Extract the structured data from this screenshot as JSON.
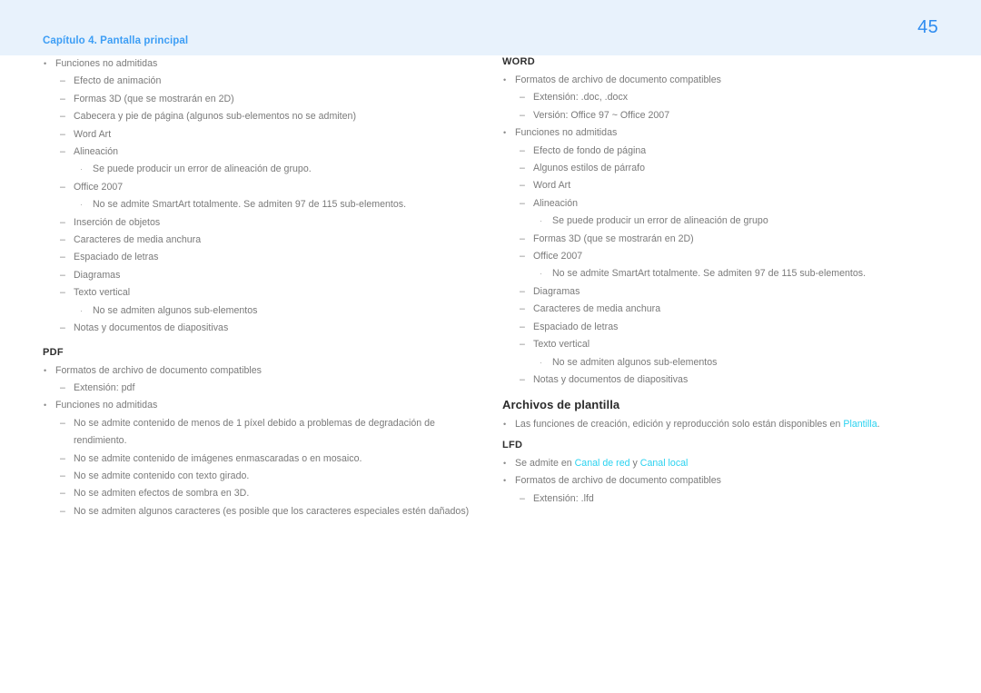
{
  "header": {
    "chapter_title": "Capítulo 4. Pantalla principal",
    "page_number": "45",
    "band_color": "#e8f2fc",
    "title_color": "#3d9ef5",
    "page_number_color": "#2e8cf0"
  },
  "colors": {
    "body_text": "#7a7a7a",
    "heading": "#2e2e2e",
    "link": "#2ad2f0"
  },
  "markers": {
    "bullet": "•",
    "dash": "–",
    "dot": "·"
  },
  "left_column": {
    "blocks": [
      {
        "type": "list",
        "items": [
          {
            "level": 1,
            "text": "Funciones no admitidas"
          },
          {
            "level": 2,
            "text": "Efecto de animación"
          },
          {
            "level": 2,
            "text": "Formas 3D (que se mostrarán en  2D)"
          },
          {
            "level": 2,
            "text": "Cabecera y pie de página (algunos sub-elementos no se admiten)"
          },
          {
            "level": 2,
            "text": "Word Art"
          },
          {
            "level": 2,
            "text": "Alineación"
          },
          {
            "level": 3,
            "text": "Se puede producir un error de alineación de grupo."
          },
          {
            "level": 2,
            "text": "Office 2007"
          },
          {
            "level": 3,
            "text": "No se admite SmartArt totalmente. Se admiten 97 de 115 sub-elementos."
          },
          {
            "level": 2,
            "text": "Inserción de objetos"
          },
          {
            "level": 2,
            "text": "Caracteres de media anchura"
          },
          {
            "level": 2,
            "text": "Espaciado de letras"
          },
          {
            "level": 2,
            "text": "Diagramas"
          },
          {
            "level": 2,
            "text": "Texto vertical"
          },
          {
            "level": 3,
            "text": "No se admiten algunos sub-elementos"
          },
          {
            "level": 2,
            "text": "Notas y documentos de diapositivas"
          }
        ]
      },
      {
        "type": "heading_caps",
        "text": "PDF"
      },
      {
        "type": "list",
        "items": [
          {
            "level": 1,
            "text": "Formatos de archivo de documento compatibles"
          },
          {
            "level": 2,
            "text": "Extensión: pdf"
          },
          {
            "level": 1,
            "text": "Funciones no admitidas"
          },
          {
            "level": 2,
            "text": "No se admite contenido de menos de 1 píxel debido a problemas de degradación de rendimiento."
          },
          {
            "level": 2,
            "text": "No se admite contenido de imágenes enmascaradas o en mosaico."
          },
          {
            "level": 2,
            "text": "No se admite contenido con texto girado."
          },
          {
            "level": 2,
            "text": "No se admiten efectos de sombra en 3D."
          },
          {
            "level": 2,
            "text": "No se admiten algunos caracteres (es posible que los caracteres especiales estén dañados)"
          }
        ]
      }
    ]
  },
  "right_column": {
    "word_heading": "WORD",
    "word_items": [
      {
        "level": 1,
        "text": "Formatos de archivo de documento compatibles"
      },
      {
        "level": 2,
        "text": "Extensión: .doc, .docx"
      },
      {
        "level": 2,
        "text": "Versión: Office 97 ~ Office 2007"
      },
      {
        "level": 1,
        "text": "Funciones no admitidas"
      },
      {
        "level": 2,
        "text": "Efecto de fondo de página"
      },
      {
        "level": 2,
        "text": "Algunos estilos de párrafo"
      },
      {
        "level": 2,
        "text": "Word Art"
      },
      {
        "level": 2,
        "text": "Alineación"
      },
      {
        "level": 3,
        "text": "Se puede producir un error de alineación de grupo"
      },
      {
        "level": 2,
        "text": "Formas 3D (que se mostrarán en  2D)"
      },
      {
        "level": 2,
        "text": "Office 2007"
      },
      {
        "level": 3,
        "text": "No se admite SmartArt totalmente. Se admiten 97 de 115 sub-elementos."
      },
      {
        "level": 2,
        "text": "Diagramas"
      },
      {
        "level": 2,
        "text": "Caracteres de media anchura"
      },
      {
        "level": 2,
        "text": "Espaciado de letras"
      },
      {
        "level": 2,
        "text": "Texto vertical"
      },
      {
        "level": 3,
        "text": "No se admiten algunos sub-elementos"
      },
      {
        "level": 2,
        "text": "Notas y documentos de diapositivas"
      }
    ],
    "template_heading": "Archivos de plantilla",
    "template_item": {
      "prefix": "Las funciones de creación, edición y reproducción solo están disponibles en ",
      "link": "Plantilla",
      "suffix": "."
    },
    "lfd_heading": "LFD",
    "lfd_first_item": {
      "prefix": "Se admite en ",
      "link1": "Canal de red",
      "middle": " y ",
      "link2": "Canal local"
    },
    "lfd_items": [
      {
        "level": 1,
        "text": "Formatos de archivo de documento compatibles"
      },
      {
        "level": 2,
        "text": "Extensión: .lfd"
      }
    ]
  }
}
